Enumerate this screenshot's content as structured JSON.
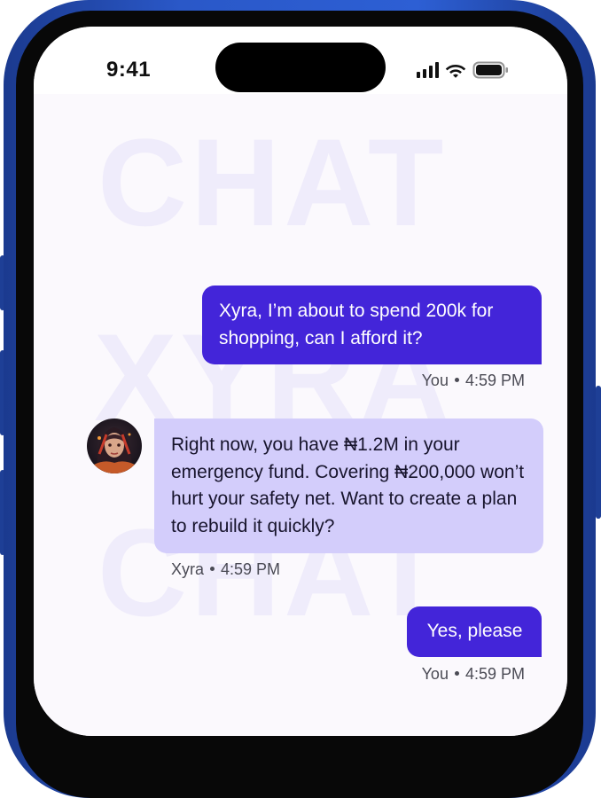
{
  "status_bar": {
    "time": "9:41"
  },
  "watermark": {
    "line1": "CHAT",
    "line2": "XYRA",
    "line3": "CHAT"
  },
  "messages": [
    {
      "sender": "You",
      "text": "Xyra, I’m about to spend 200k for shopping, can I afford it?",
      "time": "4:59 PM"
    },
    {
      "sender": "Xyra",
      "text": "Right now, you have ₦1.2M in your emergency fund. Covering ₦200,000 won’t hurt your safety net. Want to create a plan to rebuild it quickly?",
      "time": "4:59 PM"
    },
    {
      "sender": "You",
      "text": "Yes, please",
      "time": "4:59 PM"
    }
  ],
  "colors": {
    "frame": "#2a58c8",
    "user_bubble": "#4325d9",
    "ai_bubble": "#d3cdfb",
    "chat_background": "#fbf9fd",
    "watermark": "#efecfb"
  },
  "icons": [
    "signal-icon",
    "wifi-icon",
    "battery-icon"
  ]
}
